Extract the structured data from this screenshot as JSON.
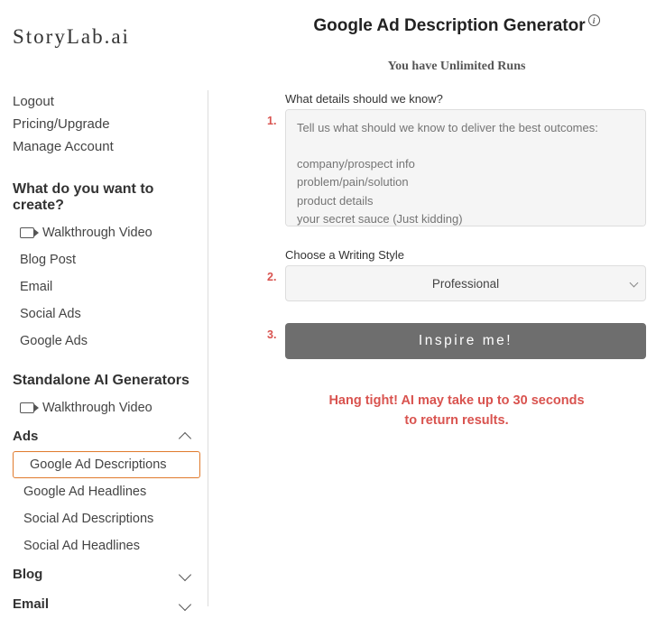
{
  "brand": "StoryLab.ai",
  "account_links": {
    "logout": "Logout",
    "pricing": "Pricing/Upgrade",
    "manage": "Manage Account"
  },
  "create": {
    "title": "What do you want to create?",
    "walkthrough": "Walkthrough Video",
    "items": {
      "blog": "Blog Post",
      "email": "Email",
      "social": "Social Ads",
      "google": "Google Ads"
    }
  },
  "standalone": {
    "title": "Standalone AI Generators",
    "walkthrough": "Walkthrough Video",
    "groups": {
      "ads": {
        "label": "Ads",
        "items": {
          "gad_desc": "Google Ad Descriptions",
          "gad_head": "Google Ad Headlines",
          "sad_desc": "Social Ad Descriptions",
          "sad_head": "Social Ad Headlines"
        }
      },
      "blog": {
        "label": "Blog"
      },
      "email": {
        "label": "Email"
      }
    }
  },
  "main": {
    "title": "Google Ad Description Generator",
    "runs": "You have Unlimited Runs",
    "steps": {
      "s1": "1.",
      "s2": "2.",
      "s3": "3."
    },
    "details_label": "What details should we know?",
    "details_placeholder": "Tell us what should we know to deliver the best outcomes:\n\ncompany/prospect info\nproblem/pain/solution\nproduct details\nyour secret sauce (Just kidding)",
    "style_label": "Choose a Writing Style",
    "style_value": "Professional",
    "cta": "Inspire me!",
    "wait_line1": "Hang tight! AI may take up to 30 seconds",
    "wait_line2": "to return results."
  }
}
